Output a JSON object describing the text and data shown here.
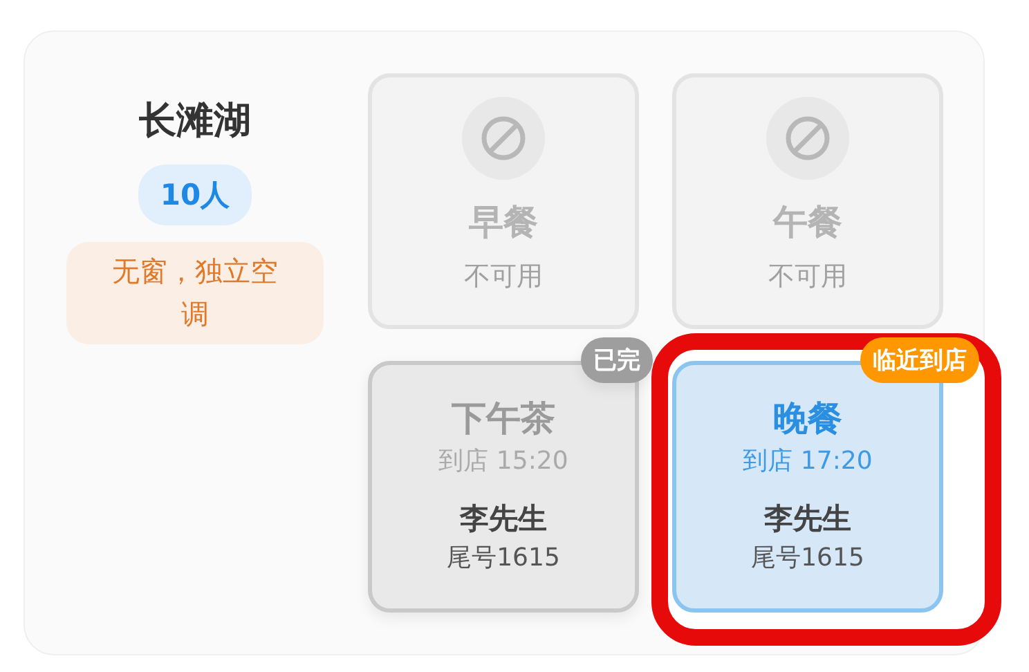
{
  "room": {
    "name": "长滩湖",
    "capacity": "10人",
    "note": "无窗，独立空调"
  },
  "slots": [
    {
      "kind": "unavailable",
      "meal": "早餐",
      "status": "不可用",
      "highlighted": false
    },
    {
      "kind": "unavailable",
      "meal": "午餐",
      "status": "不可用",
      "highlighted": false
    },
    {
      "kind": "done",
      "meal": "下午茶",
      "arrival": "到店 15:20",
      "guest": "李先生",
      "phone": "尾号1615",
      "badge": "已完",
      "highlighted": false
    },
    {
      "kind": "arriving",
      "meal": "晚餐",
      "arrival": "到店 17:20",
      "guest": "李先生",
      "phone": "尾号1615",
      "badge": "临近到店",
      "highlighted": true
    }
  ]
}
